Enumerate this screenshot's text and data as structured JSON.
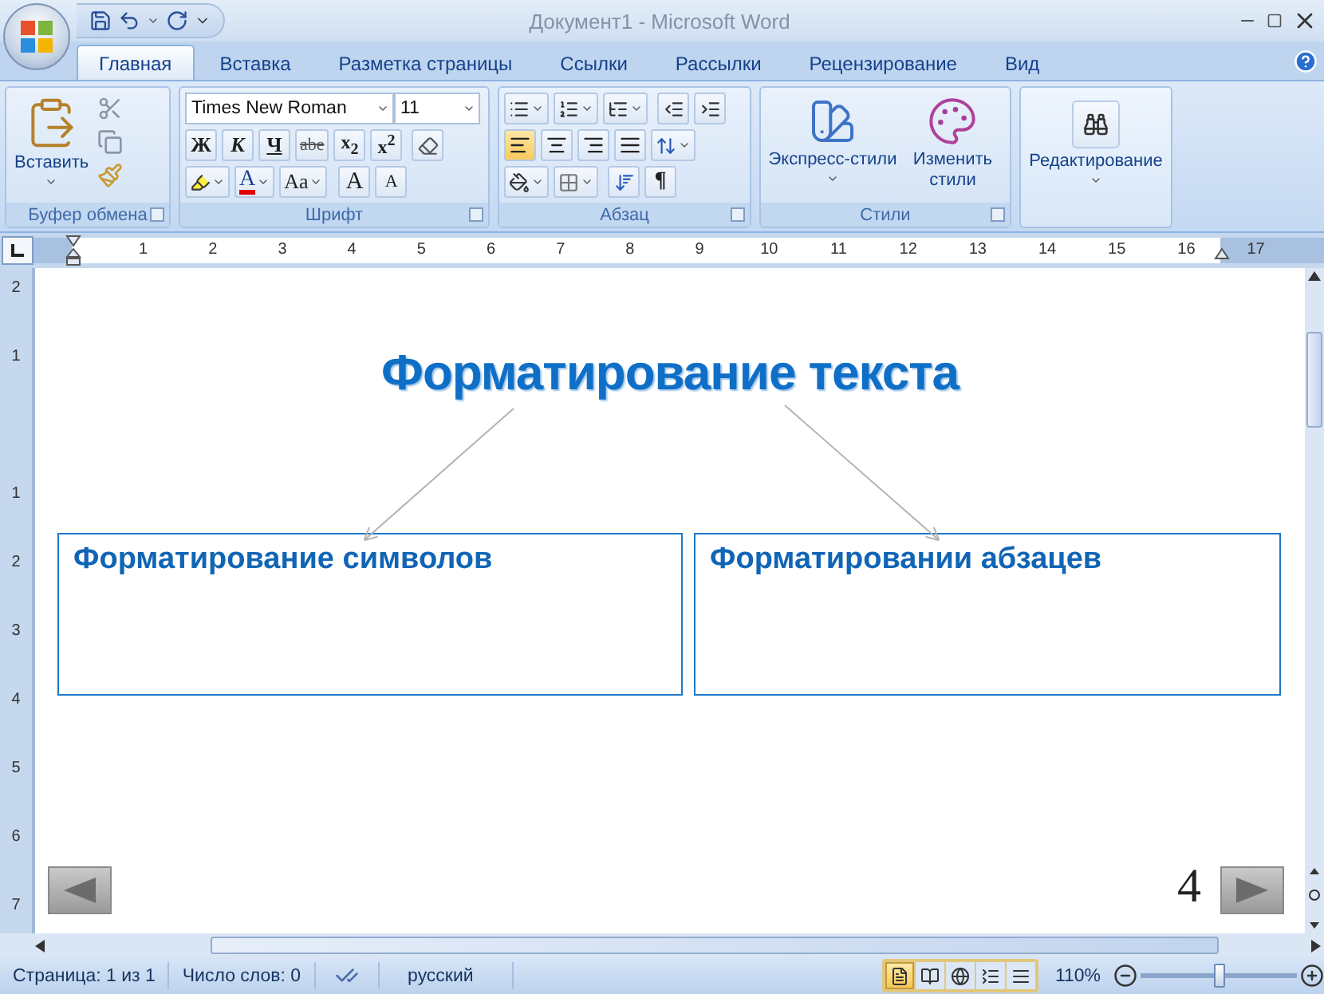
{
  "window": {
    "title": "Документ1 - Microsoft Word"
  },
  "tabs": [
    {
      "label": "Главная",
      "selected": true
    },
    {
      "label": "Вставка",
      "selected": false
    },
    {
      "label": "Разметка страницы",
      "selected": false
    },
    {
      "label": "Ссылки",
      "selected": false
    },
    {
      "label": "Рассылки",
      "selected": false
    },
    {
      "label": "Рецензирование",
      "selected": false
    },
    {
      "label": "Вид",
      "selected": false
    }
  ],
  "ribbon": {
    "clipboard": {
      "label": "Буфер обмена",
      "paste": "Вставить"
    },
    "font": {
      "label": "Шрифт",
      "font_name": "Times New Roman",
      "font_size": "11",
      "format_buttons": [
        {
          "label": "Ж",
          "kind": "bold"
        },
        {
          "label": "К",
          "kind": "italic"
        },
        {
          "label": "Ч",
          "kind": "underline"
        },
        {
          "label": "abe",
          "kind": "strike"
        },
        {
          "label": "x$_{2}$",
          "kind": "sub"
        },
        {
          "label": "x$^{2}$",
          "kind": "sup"
        }
      ],
      "font_color": "A",
      "change_case": "Aa",
      "grow": "A",
      "shrink": "A"
    },
    "paragraph": {
      "label": "Абзац",
      "align": [
        {
          "kind": "left",
          "selected": true
        },
        {
          "kind": "center",
          "selected": false
        },
        {
          "kind": "right",
          "selected": false
        },
        {
          "kind": "justify",
          "selected": false
        }
      ],
      "pilcrow": "¶"
    },
    "styles": {
      "label": "Стили",
      "quick": "Экспресс-стили",
      "change": "Изменить стили"
    },
    "editing": {
      "label": "Редактирование"
    }
  },
  "ruler": {
    "marks": [
      "1",
      "2",
      "3",
      "4",
      "5",
      "6",
      "7",
      "8",
      "9",
      "10",
      "11",
      "12",
      "13",
      "14",
      "15",
      "16",
      "17"
    ]
  },
  "vruler": {
    "above": [
      "2",
      "1"
    ],
    "below": [
      "1",
      "2",
      "3",
      "4",
      "5",
      "6",
      "7"
    ]
  },
  "document": {
    "title": "Форматирование текста",
    "boxes": [
      "Форматирование символов",
      "Форматировании абзацев"
    ],
    "page_number": "4"
  },
  "status_bar": {
    "page": "Страница: 1 из 1",
    "words": "Число слов: 0",
    "language": "русский",
    "views": [
      {
        "kind": "print",
        "selected": true
      },
      {
        "kind": "reading",
        "selected": false
      },
      {
        "kind": "web",
        "selected": false
      },
      {
        "kind": "outline",
        "selected": false
      },
      {
        "kind": "draft",
        "selected": false
      }
    ],
    "zoom": "110%",
    "zoom_slider": {
      "level": 0.5
    }
  }
}
